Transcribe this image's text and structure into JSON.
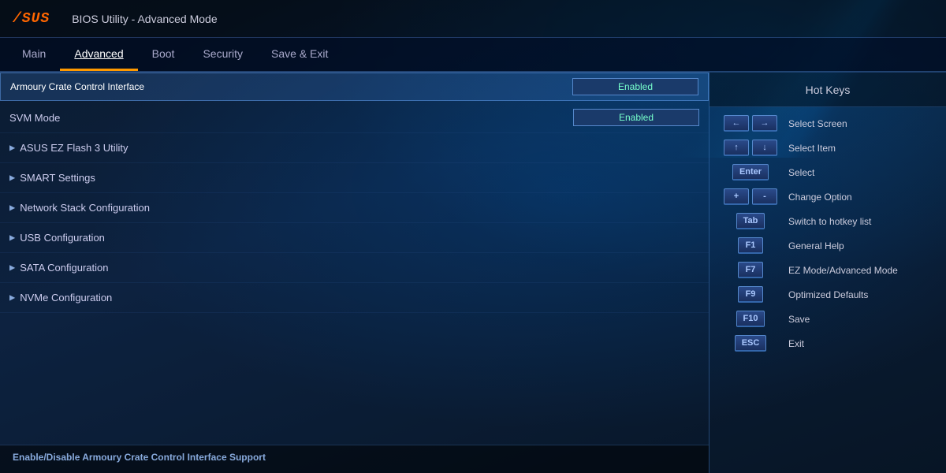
{
  "header": {
    "logo": "/SUS",
    "title": "BIOS Utility - Advanced Mode"
  },
  "navbar": {
    "items": [
      {
        "id": "main",
        "label": "Main",
        "active": false
      },
      {
        "id": "advanced",
        "label": "Advanced",
        "active": true
      },
      {
        "id": "boot",
        "label": "Boot",
        "active": false
      },
      {
        "id": "security",
        "label": "Security",
        "active": false
      },
      {
        "id": "save-exit",
        "label": "Save & Exit",
        "active": false
      }
    ]
  },
  "selected_row": {
    "label": "Armoury Crate Control Interface",
    "value": "Enabled"
  },
  "menu_rows": [
    {
      "id": "svm-mode",
      "label": "SVM Mode",
      "value": "Enabled",
      "has_arrow": false
    },
    {
      "id": "ez-flash",
      "label": "ASUS EZ Flash 3 Utility",
      "value": "",
      "has_arrow": true
    },
    {
      "id": "smart-settings",
      "label": "SMART Settings",
      "value": "",
      "has_arrow": true
    },
    {
      "id": "network-stack",
      "label": "Network Stack Configuration",
      "value": "",
      "has_arrow": true
    },
    {
      "id": "usb-config",
      "label": "USB Configuration",
      "value": "",
      "has_arrow": true
    },
    {
      "id": "sata-config",
      "label": "SATA Configuration",
      "value": "",
      "has_arrow": true
    },
    {
      "id": "nvme-config",
      "label": "NVMe Configuration",
      "value": "",
      "has_arrow": true
    }
  ],
  "status_bar": {
    "text": "Enable/Disable Armoury Crate Control Interface Support"
  },
  "hotkeys": {
    "title": "Hot Keys",
    "items": [
      {
        "id": "select-screen",
        "keys": [
          "←",
          "→"
        ],
        "description": "Select Screen"
      },
      {
        "id": "select-item",
        "keys": [
          "↑",
          "↓"
        ],
        "description": "Select Item"
      },
      {
        "id": "select",
        "keys": [
          "Enter"
        ],
        "description": "Select"
      },
      {
        "id": "change-option",
        "keys": [
          "+",
          "-"
        ],
        "description": "Change Option"
      },
      {
        "id": "hotkey-list",
        "keys": [
          "Tab"
        ],
        "description": "Switch to hotkey list"
      },
      {
        "id": "general-help",
        "keys": [
          "F1"
        ],
        "description": "General Help"
      },
      {
        "id": "ez-advanced-mode",
        "keys": [
          "F7"
        ],
        "description": "EZ Mode/Advanced Mode"
      },
      {
        "id": "optimized-defaults",
        "keys": [
          "F9"
        ],
        "description": "Optimized Defaults"
      },
      {
        "id": "save",
        "keys": [
          "F10"
        ],
        "description": "Save"
      },
      {
        "id": "exit",
        "keys": [
          "ESC"
        ],
        "description": "Exit"
      }
    ]
  }
}
